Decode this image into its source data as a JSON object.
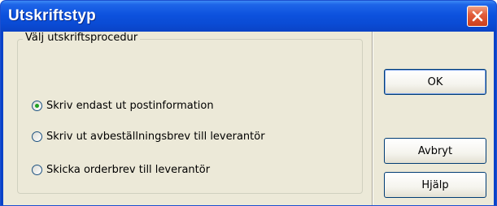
{
  "window": {
    "title": "Utskriftstyp"
  },
  "group": {
    "label": "Välj utskriftsprocedur",
    "options": [
      {
        "label": "Skriv endast ut postinformation",
        "selected": true
      },
      {
        "label": "Skriv ut avbeställningsbrev till leverantör",
        "selected": false
      },
      {
        "label": "Skicka orderbrev till leverantör",
        "selected": false
      }
    ]
  },
  "buttons": {
    "ok": "OK",
    "cancel": "Avbryt",
    "help": "Hjälp"
  },
  "colors": {
    "titlebar": "#0a4bd4",
    "dialog_bg": "#ece9d8",
    "close_button": "#e35d3b",
    "radio_selected": "#21a121"
  }
}
